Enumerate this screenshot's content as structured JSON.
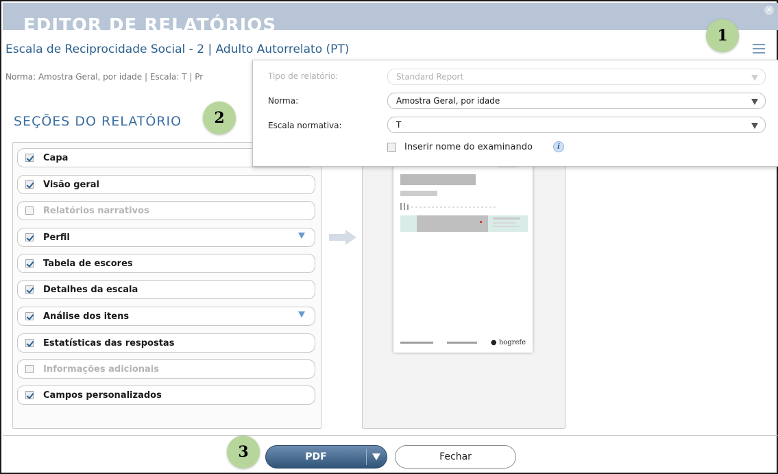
{
  "window": {
    "title": "EDITOR DE RELATÓRIOS",
    "close_icon": "close-circle-icon",
    "menu_icon": "hamburger-menu-icon"
  },
  "report": {
    "title": "Escala de Reciprocidade Social - 2 | Adulto Autorrelato (PT)",
    "norm_line": "Norma: Amostra Geral, por idade | Escala: T | Pr"
  },
  "callouts": [
    "1",
    "2",
    "3"
  ],
  "sections": {
    "heading": "SEÇÕES DO RELATÓRIO",
    "items": [
      {
        "label": "Capa",
        "checked": true,
        "enabled": true,
        "expandable": false
      },
      {
        "label": "Visão geral",
        "checked": true,
        "enabled": true,
        "expandable": false
      },
      {
        "label": "Relatórios narrativos",
        "checked": false,
        "enabled": false,
        "expandable": false
      },
      {
        "label": "Perfil",
        "checked": true,
        "enabled": true,
        "expandable": true
      },
      {
        "label": "Tabela de escores",
        "checked": true,
        "enabled": true,
        "expandable": false
      },
      {
        "label": "Detalhes da escala",
        "checked": true,
        "enabled": true,
        "expandable": false
      },
      {
        "label": "Análise dos itens",
        "checked": true,
        "enabled": true,
        "expandable": true
      },
      {
        "label": "Estatísticas das respostas",
        "checked": true,
        "enabled": true,
        "expandable": false
      },
      {
        "label": "Informações adicionais",
        "checked": false,
        "enabled": false,
        "expandable": false
      },
      {
        "label": "Campos personalizados",
        "checked": true,
        "enabled": true,
        "expandable": false
      }
    ]
  },
  "preview": {
    "logo_text": "hogrefe"
  },
  "settings_popup": {
    "report_type": {
      "label": "Tipo de relatório:",
      "value": "Standard Report",
      "enabled": false
    },
    "norm": {
      "label": "Norma:",
      "value": "Amostra Geral, por idade",
      "enabled": true
    },
    "scale": {
      "label": "Escala normativa:",
      "value": "T",
      "enabled": true
    },
    "insert_name": {
      "label": "Inserir nome do examinando",
      "checked": false
    },
    "info_icon": "info-icon"
  },
  "footer": {
    "pdf_label": "PDF",
    "close_label": "Fechar"
  },
  "colors": {
    "titlebar": "#b7c5d6",
    "accent_blue": "#2b5f8e",
    "callout_green": "#b7d69b",
    "pdf_button": "#3d6186"
  }
}
